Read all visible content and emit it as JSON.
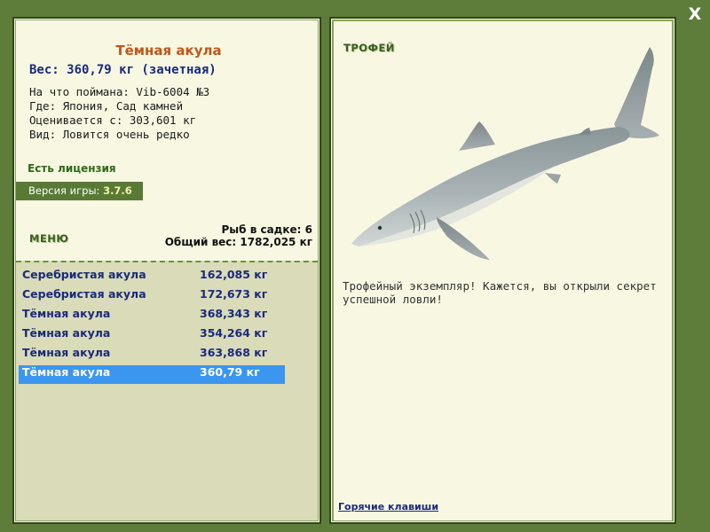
{
  "window": {
    "close_symbol": "X"
  },
  "fish": {
    "name": "Тёмная акула",
    "weight_line": "Вес: 360,79 кг (зачетная)",
    "caught_on": "На что поймана: Vib-6004 №3",
    "where": "Где: Япония, Сад камней",
    "valued_from": "Оценивается с: 303,601 кг",
    "rarity": "Вид: Ловится очень редко"
  },
  "license": "Есть лицензия",
  "version": {
    "label": "Версия игры:",
    "value": "3.7.6"
  },
  "menu_label": "МЕНЮ",
  "keepnet": {
    "count_line": "Рыб в садке: 6",
    "total_line": "Общий вес: 1782,025 кг"
  },
  "catch_list": [
    {
      "name": "Серебристая акула",
      "weight": "162,085 кг",
      "selected": false
    },
    {
      "name": "Серебристая акула",
      "weight": "172,673 кг",
      "selected": false
    },
    {
      "name": "Тёмная акула",
      "weight": "368,343 кг",
      "selected": false
    },
    {
      "name": "Тёмная акула",
      "weight": "354,264 кг",
      "selected": false
    },
    {
      "name": "Тёмная акула",
      "weight": "363,868 кг",
      "selected": false
    },
    {
      "name": "Тёмная акула",
      "weight": "360,79 кг",
      "selected": true
    }
  ],
  "trophy": {
    "label": "ТРОФЕЙ",
    "text": "Трофейный экземпляр! Кажется, вы открыли секрет успешной ловли!",
    "image_icon": "shark-icon"
  },
  "hotkeys_link": "Горячие клавиши",
  "colors": {
    "background": "#5e7d3a",
    "panel": "#f8f8e2",
    "list_area": "#d9dbb9",
    "selected_row": "#3a96ee",
    "title": "#c0561a",
    "text_blue": "#1b2a7a"
  }
}
